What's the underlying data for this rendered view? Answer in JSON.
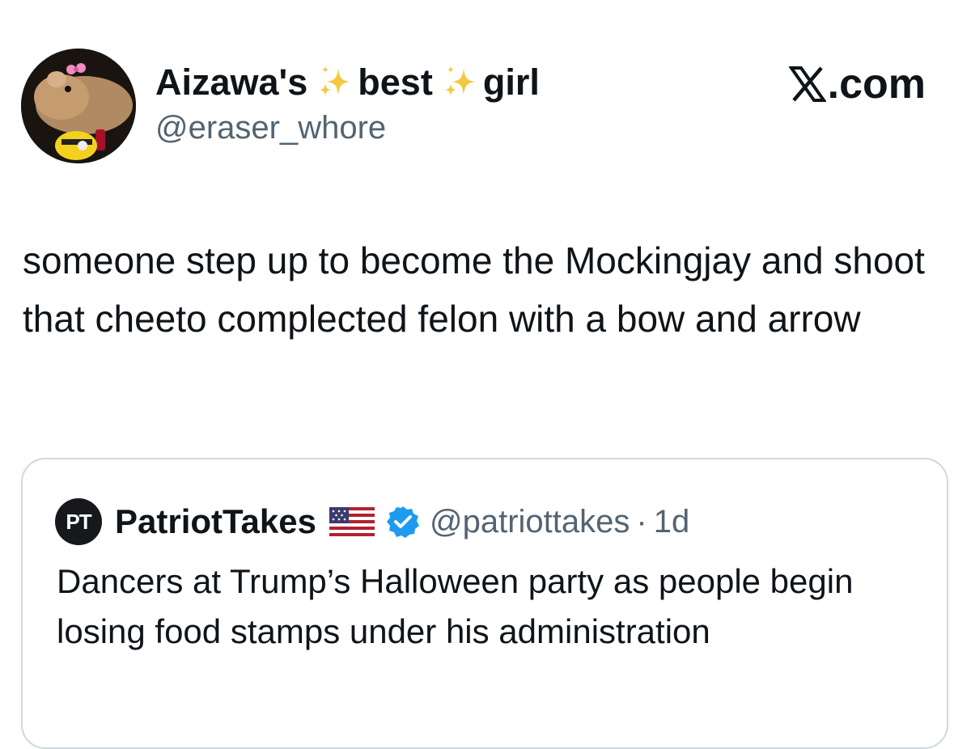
{
  "author": {
    "display_name_parts": [
      "Aizawa's",
      "best",
      "girl"
    ],
    "handle": "@eraser_whore",
    "avatar_icon": "rat-with-pink-bow-avatar"
  },
  "site_label": ".com",
  "site_logo_icon": "x-logo-icon",
  "tweet": {
    "text": "someone step up to become the Mockingjay and shoot that cheeto complected felon with a bow and arrow"
  },
  "quoted_tweet": {
    "avatar_text": "PT",
    "name": "PatriotTakes",
    "flag_icon": "us-flag-icon",
    "verified_icon": "verified-badge-icon",
    "handle": "@patriottakes",
    "separator": "·",
    "time": "1d",
    "text": "Dancers at Trump’s Halloween party as people begin losing food stamps under his administration"
  },
  "colors": {
    "text_primary": "#0f1419",
    "text_secondary": "#536471",
    "border": "#cfd9de",
    "verified_blue": "#1d9bf0",
    "sparkle_gold": "#f5c842"
  }
}
